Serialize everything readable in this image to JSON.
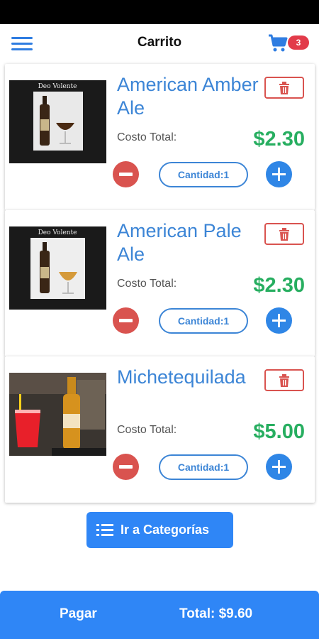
{
  "header": {
    "title": "Carrito",
    "cart_badge": "3"
  },
  "cart": {
    "cost_label": "Costo Total:",
    "items": [
      {
        "name": "American Amber Ale",
        "price": "$2.30",
        "quantity_label": "Cantidad:1",
        "image_label": "Deo Volente"
      },
      {
        "name": "American Pale Ale",
        "price": "$2.30",
        "quantity_label": "Cantidad:1",
        "image_label": "Deo Volente"
      },
      {
        "name": "Michetequilada",
        "price": "$5.00",
        "quantity_label": "Cantidad:1",
        "image_label": ""
      }
    ]
  },
  "actions": {
    "categories_label": "Ir a Categorías"
  },
  "footer": {
    "pay_label": "Pagar",
    "total_label": "Total: $9.60"
  },
  "colors": {
    "primary": "#2f86f6",
    "danger": "#d9534f",
    "price": "#27ae60"
  }
}
